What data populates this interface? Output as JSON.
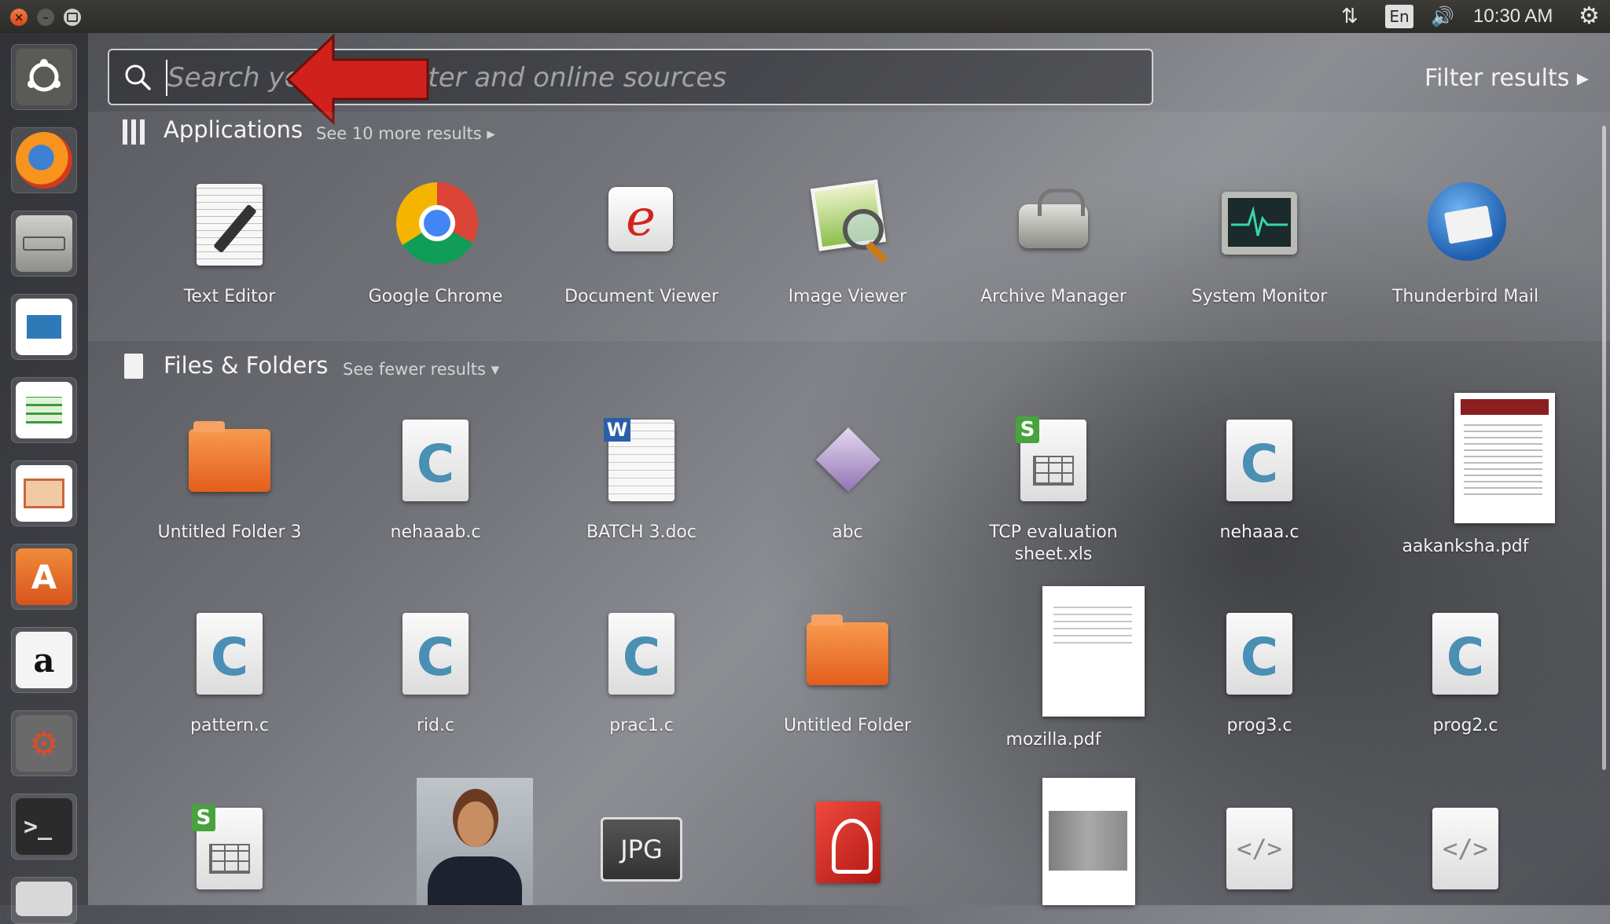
{
  "window_controls": {
    "close": "×",
    "minimize": "–"
  },
  "panel": {
    "lang": "En",
    "clock": "10:30 AM",
    "net_icon": "⇅",
    "volume_icon": "🔊",
    "settings_icon": "⚙"
  },
  "search": {
    "placeholder": "Search your computer and online sources",
    "value": ""
  },
  "filter": {
    "label": "Filter results ▸"
  },
  "applications": {
    "heading": "Applications",
    "see_more": "See 10 more results ▸",
    "items": [
      "Text Editor",
      "Google Chrome",
      "Document Viewer",
      "Image Viewer",
      "Archive Manager",
      "System Monitor",
      "Thunderbird Mail"
    ]
  },
  "files": {
    "heading": "Files & Folders",
    "see_more": "See fewer results ▾",
    "row1": [
      "Untitled Folder 3",
      "nehaaab.c",
      "BATCH 3.doc",
      "abc",
      "TCP evaluation sheet.xls",
      "nehaaa.c",
      "aakanksha.pdf"
    ],
    "row2": [
      "pattern.c",
      "rid.c",
      "prac1.c",
      "Untitled Folder",
      "mozilla.pdf",
      "prog3.c",
      "prog2.c"
    ],
    "row3_jpg_label": "JPG",
    "row3_code_label": "</>"
  },
  "launcher_icons": [
    "dash-home",
    "firefox",
    "files",
    "writer",
    "calc",
    "impress",
    "software-center",
    "amazon",
    "system-settings",
    "terminal",
    "more"
  ],
  "colors": {
    "accent": "#e95420",
    "arrow": "#d0211c"
  }
}
